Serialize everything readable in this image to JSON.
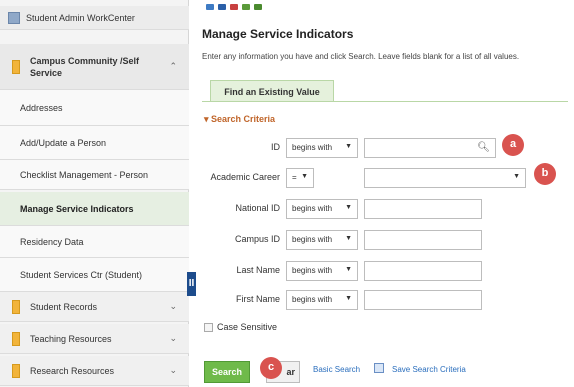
{
  "sidebar": {
    "top_item": "Student Admin WorkCenter",
    "group": {
      "label": "Campus Community /Self Service"
    },
    "links": [
      {
        "label": "Addresses"
      },
      {
        "label": "Add/Update a Person"
      },
      {
        "label": "Checklist Management - Person"
      },
      {
        "label": "Manage Service Indicators"
      },
      {
        "label": "Residency Data"
      },
      {
        "label": "Student Services Ctr (Student)"
      }
    ],
    "folders": [
      {
        "label": "Student Records"
      },
      {
        "label": "Teaching Resources"
      },
      {
        "label": "Research Resources"
      }
    ],
    "collapse_glyph": "II"
  },
  "main": {
    "title": "Manage Service Indicators",
    "instructions": "Enter any information you have and click Search. Leave fields blank for a list of all values.",
    "tab": "Find an Existing Value",
    "criteria_title": "▾ Search Criteria",
    "fields": [
      {
        "label": "ID",
        "operator": "begins with"
      },
      {
        "label": "Academic Career",
        "operator": "="
      },
      {
        "label": "National ID",
        "operator": "begins with"
      },
      {
        "label": "Campus ID",
        "operator": "begins with"
      },
      {
        "label": "Last Name",
        "operator": "begins with"
      },
      {
        "label": "First Name",
        "operator": "begins with"
      }
    ],
    "case_sensitive": "Case Sensitive",
    "search_button": "Search",
    "clear_button": "ar",
    "basic_search": "Basic Search",
    "save_search": "Save Search Criteria"
  },
  "badges": [
    "a",
    "b",
    "c"
  ],
  "colors": {
    "accent_green": "#6fba4a",
    "tab_bg": "#e5f1dc",
    "badge_red": "#d9534f",
    "criteria_orange": "#c0652a",
    "link_blue": "#2a6ebd"
  }
}
